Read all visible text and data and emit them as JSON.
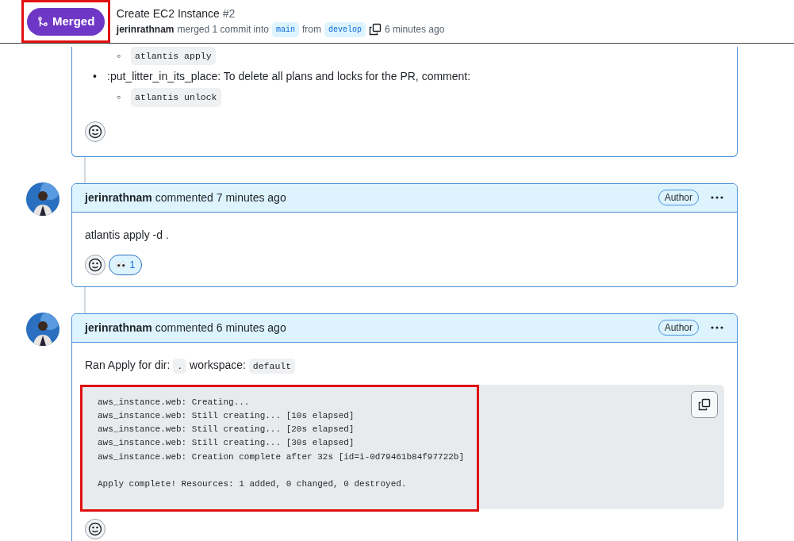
{
  "header": {
    "state": "Merged",
    "highlighted": true,
    "title": "Create EC2 Instance",
    "number": "#2",
    "author": "jerinrathnam",
    "action": "merged 1 commit into",
    "base": "main",
    "joiner": "from",
    "head": "develop",
    "time": "6 minutes ago"
  },
  "previous_comment": {
    "items": [
      {
        "kind": "sub",
        "marker": "◦",
        "code": "atlantis apply"
      },
      {
        "kind": "item",
        "marker": "•",
        "text": ":put_litter_in_its_place: To delete all plans and locks for the PR, comment:",
        "children": [
          {
            "kind": "sub",
            "marker": "◦",
            "code": "atlantis unlock"
          }
        ]
      }
    ]
  },
  "comments": [
    {
      "author": "jerinrathnam",
      "action": "commented",
      "time": "7 minutes ago",
      "badge": "Author",
      "body": [
        {
          "kind": "text",
          "text": "atlantis apply -d ."
        }
      ],
      "reactions": [
        {
          "count": "1",
          "selected": true
        }
      ]
    },
    {
      "author": "jerinrathnam",
      "action": "commented",
      "time": "6 minutes ago",
      "badge": "Author",
      "body": [
        {
          "kind": "mixed",
          "parts": [
            {
              "kind": "text",
              "text": "Ran Apply for dir:"
            },
            {
              "kind": "code",
              "text": "."
            },
            {
              "kind": "text",
              "text": "workspace:"
            },
            {
              "kind": "code",
              "text": "default"
            }
          ]
        },
        {
          "kind": "codeblock",
          "highlighted": true,
          "text": "aws_instance.web: Creating...\naws_instance.web: Still creating... [10s elapsed]\naws_instance.web: Still creating... [20s elapsed]\naws_instance.web: Still creating... [30s elapsed]\naws_instance.web: Creation complete after 32s [id=i-0d79461b84f97722b]\n\nApply complete! Resources: 1 added, 0 changed, 0 destroyed."
        }
      ]
    }
  ]
}
